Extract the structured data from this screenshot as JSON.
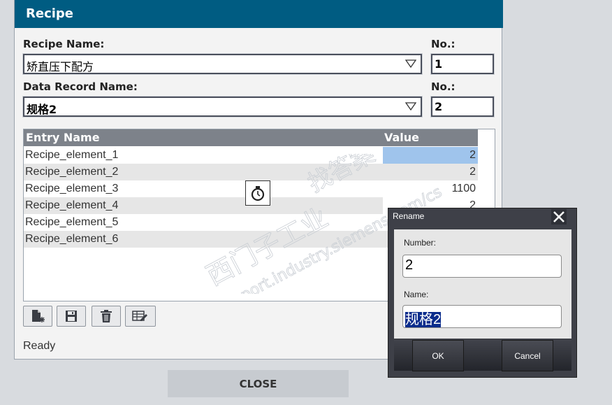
{
  "recipe": {
    "title": "Recipe",
    "recipe_name_label": "Recipe Name:",
    "recipe_name_value": "矫直压下配方",
    "no_label_1": "No.:",
    "recipe_no_value": "1",
    "data_record_label": "Data Record Name:",
    "data_record_value": "规格2",
    "no_label_2": "No.:",
    "record_no_value": "2"
  },
  "table": {
    "columns": [
      "Entry Name",
      "Value"
    ],
    "rows": [
      {
        "name": "Recipe_element_1",
        "value": "2"
      },
      {
        "name": "Recipe_element_2",
        "value": "2"
      },
      {
        "name": "Recipe_element_3",
        "value": "1100"
      },
      {
        "name": "Recipe_element_4",
        "value": "2"
      },
      {
        "name": "Recipe_element_5",
        "value": ""
      },
      {
        "name": "Recipe_element_6",
        "value": ""
      }
    ]
  },
  "toolbar": {
    "icons": [
      "new-record-icon",
      "save-icon",
      "delete-icon",
      "rename-icon"
    ]
  },
  "status": "Ready",
  "close_label": "CLOSE",
  "rename_dialog": {
    "title": "Rename",
    "number_label": "Number:",
    "number_value": "2",
    "name_label": "Name:",
    "name_value": "规格2",
    "ok_label": "OK",
    "cancel_label": "Cancel"
  },
  "watermark": {
    "line1": "西门子工业",
    "line2": "support.industry.siemens.com/cs",
    "line3": "找答案"
  },
  "colors": {
    "header": "#005c82",
    "selection": "#0a2c8c",
    "value_highlight": "#9fc4ec"
  }
}
